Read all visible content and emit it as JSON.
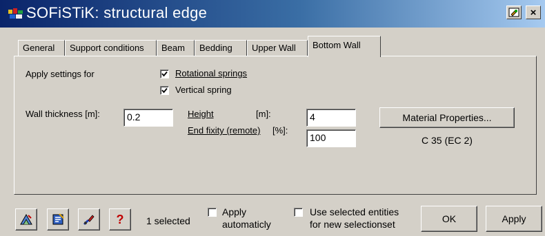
{
  "window": {
    "title": "SOFiSTiK: structural edge",
    "close_label": "×"
  },
  "tabs": [
    {
      "label": "General"
    },
    {
      "label": "Support conditions"
    },
    {
      "label": "Beam"
    },
    {
      "label": "Bedding"
    },
    {
      "label": "Upper Wall"
    },
    {
      "label": "Bottom Wall",
      "active": true
    }
  ],
  "form": {
    "apply_settings_label": "Apply settings for",
    "rotational_springs": {
      "label": "Rotational springs",
      "checked": true
    },
    "vertical_spring": {
      "label": "Vertical spring",
      "checked": true
    },
    "wall_thickness": {
      "label": "Wall thickness [m]:",
      "value": "0.2"
    },
    "height": {
      "label": "Height",
      "unit": "[m]:",
      "value": "4"
    },
    "end_fixity": {
      "label": "End fixity (remote)",
      "unit": "[%]:",
      "value": "100"
    },
    "material_button_label": "Material Properties...",
    "material_name": "C 35 (EC 2)"
  },
  "footer": {
    "icons": [
      "pick-structure-icon",
      "filter-selection-icon",
      "paint-selection-icon",
      "help-icon"
    ],
    "help_glyph": "?",
    "selected_text": "1  selected",
    "apply_auto": {
      "line1": "Apply",
      "line2": "automaticly",
      "checked": false
    },
    "use_selected": {
      "line1": "Use selected entities",
      "line2": "for new selectionset",
      "checked": false
    },
    "ok_label": "OK",
    "apply_label": "Apply"
  },
  "colors": {
    "title_gradient_start": "#0a246a",
    "title_gradient_end": "#a6caf0",
    "face": "#d4d0c8"
  }
}
